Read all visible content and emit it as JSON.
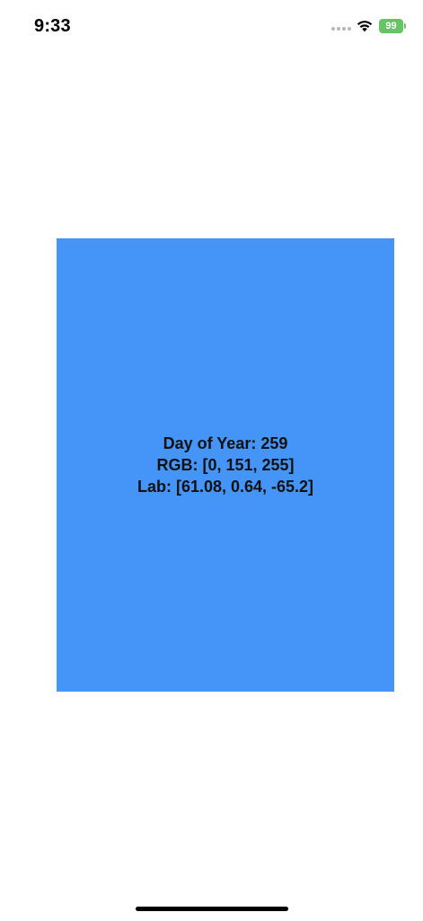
{
  "status_bar": {
    "time": "9:33",
    "battery_level": "99",
    "battery_color": "#65c466",
    "icons": [
      "signal-dots-icon",
      "wifi-icon",
      "battery-charging-icon"
    ]
  },
  "panel": {
    "background": "#4495f7",
    "day_of_year": "Day of Year: 259",
    "rgb": "RGB: [0, 151, 255]",
    "lab": "Lab: [61.08, 0.64, -65.2]"
  }
}
